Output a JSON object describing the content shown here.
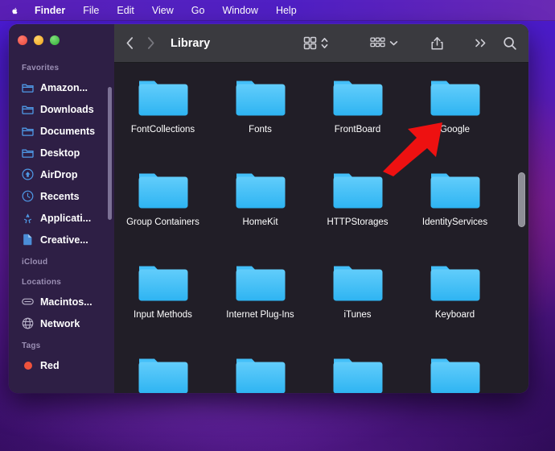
{
  "menubar": {
    "apple_icon": "apple-logo-icon",
    "items": [
      {
        "label": "Finder",
        "bold": true
      },
      {
        "label": "File",
        "bold": false
      },
      {
        "label": "Edit",
        "bold": false
      },
      {
        "label": "View",
        "bold": false
      },
      {
        "label": "Go",
        "bold": false
      },
      {
        "label": "Window",
        "bold": false
      },
      {
        "label": "Help",
        "bold": false
      }
    ]
  },
  "window": {
    "title": "Library",
    "controls": {
      "close": "close-button",
      "minimize": "minimize-button",
      "maximize": "maximize-button"
    }
  },
  "toolbar": {
    "back_icon": "chevron-left-icon",
    "forward_icon": "chevron-right-icon",
    "view_icon": "icon-view-icon",
    "view_stepper_icon": "chevron-up-down-icon",
    "group_icon": "group-by-icon",
    "group_chevron_icon": "chevron-down-icon",
    "share_icon": "share-icon",
    "more_icon": "more-chevrons-icon",
    "search_icon": "search-icon"
  },
  "sidebar": {
    "sections": [
      {
        "title": "Favorites",
        "items": [
          {
            "label": "Amazon...",
            "icon": "folder-icon"
          },
          {
            "label": "Downloads",
            "icon": "folder-icon"
          },
          {
            "label": "Documents",
            "icon": "folder-icon"
          },
          {
            "label": "Desktop",
            "icon": "folder-icon"
          },
          {
            "label": "AirDrop",
            "icon": "airdrop-icon"
          },
          {
            "label": "Recents",
            "icon": "clock-icon"
          },
          {
            "label": "Applicati...",
            "icon": "applications-icon"
          },
          {
            "label": "Creative...",
            "icon": "document-icon"
          }
        ]
      },
      {
        "title": "iCloud",
        "items": []
      },
      {
        "title": "Locations",
        "items": [
          {
            "label": "Macintos...",
            "icon": "hard-drive-icon"
          },
          {
            "label": "Network",
            "icon": "network-globe-icon"
          }
        ]
      },
      {
        "title": "Tags",
        "items": [
          {
            "label": "Red",
            "icon": "tag-dot-icon",
            "color": "#f0523c"
          }
        ]
      }
    ]
  },
  "file_grid": {
    "rows": [
      [
        {
          "label": "FontCollections",
          "icon": "folder-icon"
        },
        {
          "label": "Fonts",
          "icon": "folder-icon"
        },
        {
          "label": "FrontBoard",
          "icon": "folder-icon"
        },
        {
          "label": "Google",
          "icon": "folder-icon"
        }
      ],
      [
        {
          "label": "Group Containers",
          "icon": "folder-icon"
        },
        {
          "label": "HomeKit",
          "icon": "folder-icon"
        },
        {
          "label": "HTTPStorages",
          "icon": "folder-icon"
        },
        {
          "label": "IdentityServices",
          "icon": "folder-icon"
        }
      ],
      [
        {
          "label": "Input Methods",
          "icon": "folder-icon"
        },
        {
          "label": "Internet Plug-Ins",
          "icon": "folder-icon"
        },
        {
          "label": "iTunes",
          "icon": "folder-icon"
        },
        {
          "label": "Keyboard",
          "icon": "folder-icon"
        }
      ],
      [
        {
          "label": "",
          "icon": "folder-icon"
        },
        {
          "label": "",
          "icon": "folder-icon"
        },
        {
          "label": "",
          "icon": "folder-icon"
        },
        {
          "label": "",
          "icon": "folder-icon"
        }
      ]
    ]
  },
  "annotation": {
    "arrow": "red-arrow-pointing-to-google-folder",
    "color": "#ee1111"
  },
  "colors": {
    "folder_blue": "#4FC3F7",
    "sidebar_icon_blue": "#4a90e2",
    "accent_red": "#ee1111",
    "toolbar_gray": "#3a3a3f",
    "content_bg": "#211e27"
  }
}
